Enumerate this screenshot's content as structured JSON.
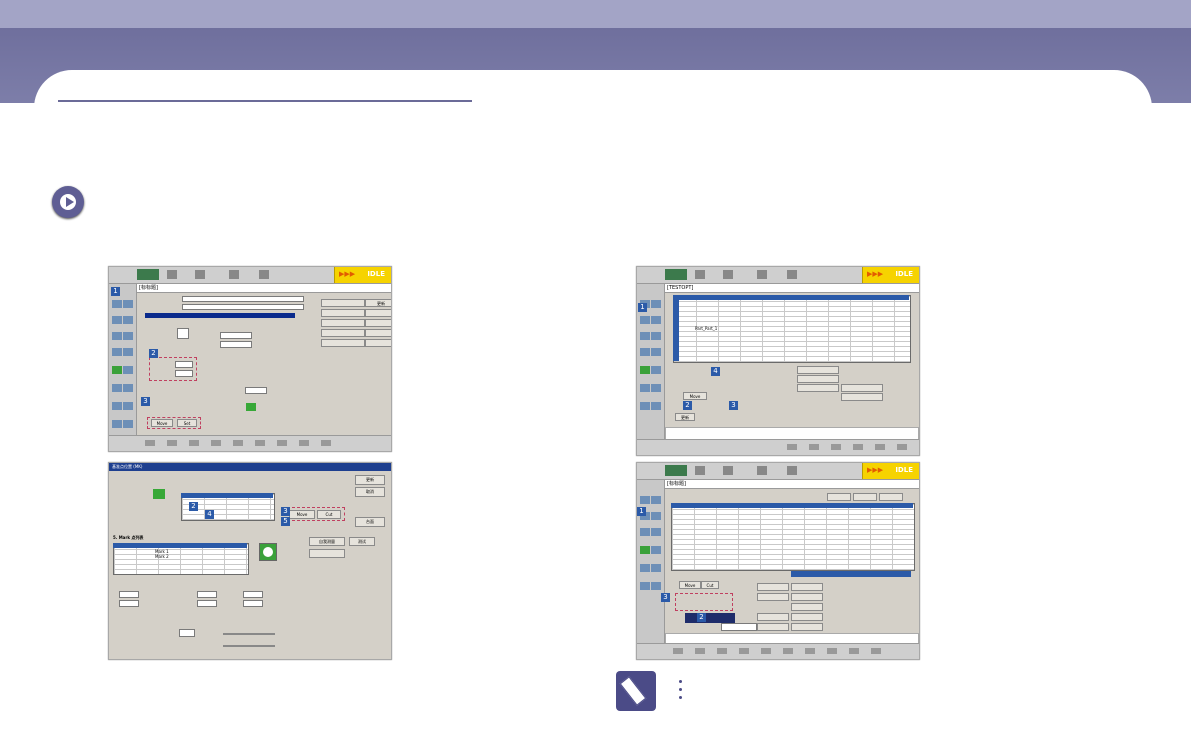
{
  "colors": {
    "banner": "#6f6f9d",
    "accent": "#2b5aa8",
    "idle_bg": "#f6d300",
    "note_icon": "#4b4b87"
  },
  "icons": {
    "play": "play-circle-icon",
    "note": "pencil-note-icon"
  },
  "toolbar": {
    "idle": "IDLE",
    "arrows": "▶▶▶"
  },
  "screens": [
    {
      "header": "[标标题]",
      "badges": [
        "1",
        "2",
        "3"
      ],
      "buttons": [
        "更新",
        "Move",
        "Set"
      ],
      "fields": [
        "0.000",
        "100.000"
      ]
    },
    {
      "header": "基准点位置 (MK)",
      "badges": [
        "1",
        "2",
        "3",
        "4",
        "5"
      ],
      "buttons": [
        "更新",
        "取消",
        "台面",
        "自我测量",
        "测试",
        "Move",
        "Cut"
      ],
      "table_title": "5. Mark 点列表",
      "rows": [
        "Mark 1",
        "Mark 2"
      ],
      "values": [
        "1.000",
        "0.000",
        "4.000",
        "100.000"
      ]
    },
    {
      "header": "[TESTOPT]",
      "badges": [
        "1",
        "2",
        "3",
        "4"
      ],
      "row_label": "Part_Part_1",
      "buttons": [
        "Move",
        "更新"
      ]
    },
    {
      "header": "[标标题]",
      "badges": [
        "1",
        "2",
        "3"
      ],
      "buttons": [
        "Move",
        "Cut"
      ]
    }
  ]
}
